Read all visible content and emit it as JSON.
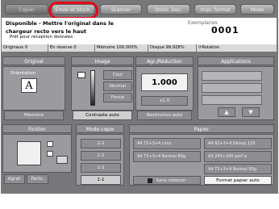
{
  "tabs": [
    {
      "label": "Copier",
      "active": true
    },
    {
      "label": "Envoi et Stock."
    },
    {
      "label": "Scanner"
    },
    {
      "label": "Stock. Doc."
    },
    {
      "label": "Impr. format"
    },
    {
      "label": "Mode"
    }
  ],
  "message": {
    "line1": "Disponible - Mettre l'original dans le",
    "line2": "chargeur recto vers le haut",
    "line3": "Prêt pour réception données",
    "copies_label": "Exemplaires",
    "copies_value": "0001",
    "ticker": "!!!!!!!!!!!!!!!!!!!!!!!!!!!!!!!!!!!!!!!!"
  },
  "status_bar": {
    "originals": "Originaux",
    "originals_count": "0",
    "reserve": "En réserve",
    "reserve_count": "0",
    "memory": "Mémoire 100.000%",
    "disk": "Disque",
    "disk_value": "99.928%",
    "rotation": "Rotation"
  },
  "original": {
    "header": "Original",
    "orientation_label": "Orientation",
    "orientation_glyph": "A",
    "memory_button": "Mémoire"
  },
  "image": {
    "header": "Image",
    "clair": "Clair",
    "normal": "Normal",
    "fonce": "Foncé",
    "contrast_auto": "Contraste auto"
  },
  "zoom": {
    "header": "Agr./Réduction",
    "value": "1.000",
    "factor": "x1.0",
    "restitution": "Restitution auto"
  },
  "applications": {
    "header": "Applications",
    "up_arrow": "▲",
    "down_arrow": "▼"
  },
  "finition": {
    "header": "Finition",
    "agraf": "Agraf.",
    "perfo": "Perfo."
  },
  "mode_copie": {
    "header": "Mode copie",
    "options": [
      "2-2",
      "2-1",
      "1-2",
      "1-1"
    ]
  },
  "papier": {
    "header": "Papier",
    "trays": [
      {
        "size": "A4",
        "tray": "T2+3+4",
        "type": "conc."
      },
      {
        "size": "A4",
        "tray": "T3+3+4",
        "type": "Normal 80g"
      },
      {
        "size": "A4",
        "tray": "62+3+4",
        "type": "Glossy 120"
      },
      {
        "size": "A3",
        "tray": "245+300",
        "type": "perf a"
      },
      {
        "size": "A4",
        "tray": "T2+3+4",
        "type": "Normal 80g"
      }
    ],
    "no_rotation": "Sans rotation",
    "format_auto": "Format papier auto"
  }
}
